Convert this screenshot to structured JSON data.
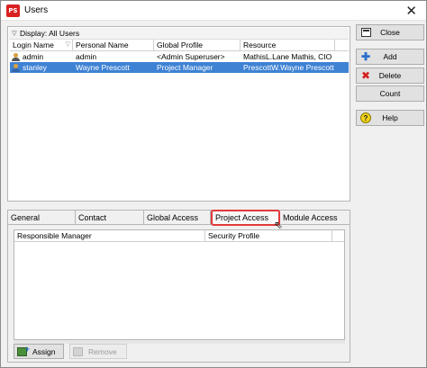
{
  "window": {
    "title": "Users",
    "app_icon": "PS"
  },
  "list": {
    "group_label": "Display: All Users",
    "columns": [
      "Login Name",
      "Personal Name",
      "Global Profile",
      "Resource"
    ],
    "rows": [
      {
        "login": "admin",
        "personal": "admin",
        "profile": "<Admin Superuser>",
        "resource": "MathisL.Lane Mathis, CIO",
        "selected": false
      },
      {
        "login": "stanley",
        "personal": "Wayne Prescott",
        "profile": "Project Manager",
        "resource": "PrescottW.Wayne Prescott",
        "selected": true
      }
    ]
  },
  "buttons": {
    "close": "Close",
    "add": "Add",
    "delete": "Delete",
    "count": "Count",
    "help": "Help"
  },
  "tabs": [
    "General",
    "Contact",
    "Global Access",
    "Project Access",
    "Module Access"
  ],
  "active_tab": "Project Access",
  "project_access": {
    "columns": [
      "Responsible Manager",
      "Security Profile"
    ],
    "assign_label": "Assign",
    "remove_label": "Remove"
  },
  "colors": {
    "selection": "#3f82d4",
    "highlight": "#e23a3a",
    "app_icon": "#d92020"
  }
}
